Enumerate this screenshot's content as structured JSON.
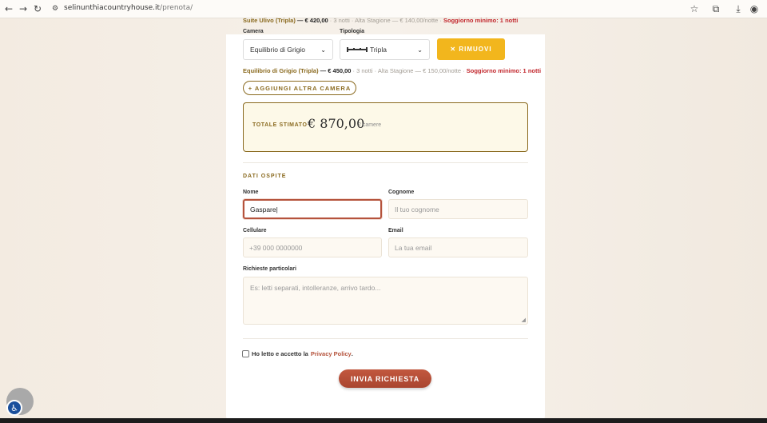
{
  "browser": {
    "domain": "selinunthiacountryhouse.it",
    "path": "/prenota/"
  },
  "booking": {
    "prev_line": {
      "room": "Suite Ulivo (Tripla)",
      "sep": " — ",
      "price": "€ 420,00",
      "nights": " · 3 notti · Alta Stagione — € 140,00/notte · ",
      "minstay": "Soggiorno minimo: 1 notti"
    },
    "camera_label": "Camera",
    "tipologia_label": "Tipologia",
    "camera_value": "Equilibrio di Grigio",
    "tipologia_value": "Tripla",
    "remove_label": "✕ RIMUOVI",
    "line": {
      "room": "Equilibrio di Grigio (Tripla)",
      "sep": " — ",
      "price": "€ 450,00",
      "nights": " · 3 notti · Alta Stagione — € 150,00/notte · ",
      "minstay": "Soggiorno minimo: 1 notti"
    },
    "add_room_label": "+ AGGIUNGI ALTRA CAMERA",
    "total_label": "TOTALE STIMATO",
    "total_value": "€ 870,00",
    "total_count": "2 camere"
  },
  "guest": {
    "section_title": "DATI OSPITE",
    "nome_label": "Nome",
    "nome_value": "Gaspare",
    "cognome_label": "Cognome",
    "cognome_placeholder": "Il tuo cognome",
    "cellulare_label": "Cellulare",
    "cellulare_placeholder": "+39 000 0000000",
    "email_label": "Email",
    "email_placeholder": "La tua email",
    "richieste_label": "Richieste particolari",
    "richieste_placeholder": "Es: letti separati, intolleranze, arrivo tardo...",
    "privacy_text": "Ho letto e accetto la",
    "privacy_link": "Privacy Policy",
    "privacy_end": ".",
    "submit_label": "INVIA RICHIESTA"
  },
  "colors": {
    "accent_gold": "#8a6a1f",
    "remove_yellow": "#f2b61d",
    "submit_red": "#b5533c",
    "warning_red": "#c2272d"
  }
}
